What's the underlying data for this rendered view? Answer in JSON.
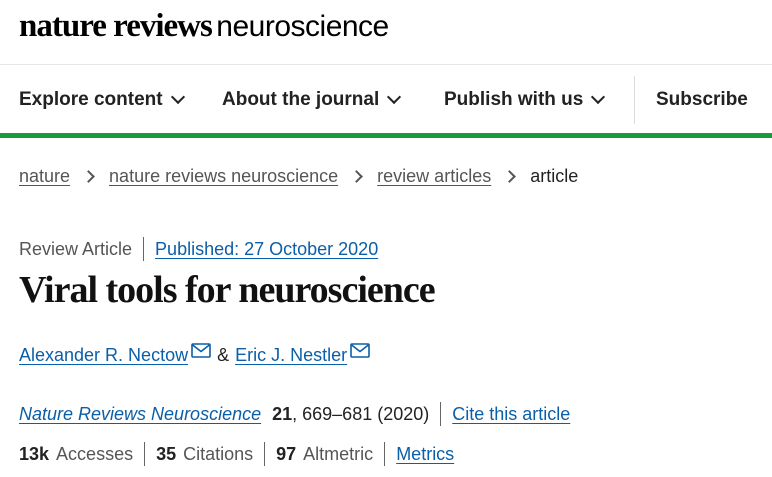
{
  "masthead": {
    "brand": "nature reviews",
    "journal": "neuroscience"
  },
  "nav": {
    "items": [
      {
        "label": "Explore content",
        "has_dropdown": true
      },
      {
        "label": "About the journal",
        "has_dropdown": true
      },
      {
        "label": "Publish with us",
        "has_dropdown": true
      }
    ],
    "subscribe": "Subscribe",
    "accent_color": "#1a9b3a"
  },
  "breadcrumb": {
    "items": [
      "nature",
      "nature reviews neuroscience",
      "review articles"
    ],
    "current": "article"
  },
  "article": {
    "type": "Review Article",
    "published": "Published: 27 October 2020",
    "title": "Viral tools for neuroscience",
    "authors": [
      {
        "name": "Alexander R. Nectow"
      },
      {
        "name": "Eric J. Nestler"
      }
    ],
    "author_separator": "&",
    "journal": "Nature Reviews Neuroscience",
    "volume": "21",
    "pages_year": ", 669–681 (2020)",
    "cite": "Cite this article",
    "link_color": "#0b5ea8"
  },
  "metrics": {
    "accesses": {
      "value": "13k",
      "label": "Accesses"
    },
    "citations": {
      "value": "35",
      "label": "Citations"
    },
    "altmetric": {
      "value": "97",
      "label": "Altmetric"
    },
    "link": "Metrics"
  }
}
